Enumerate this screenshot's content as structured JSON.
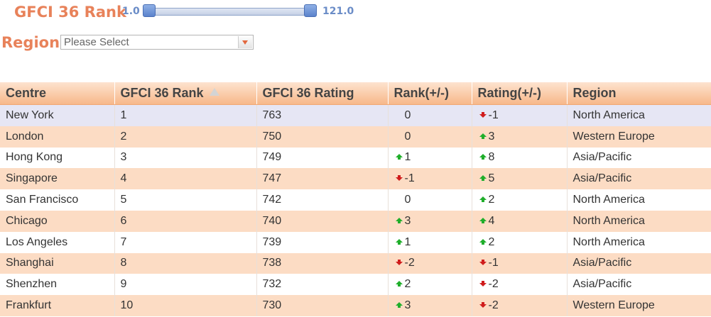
{
  "filters": {
    "rank_label": "GFCI 36 Rank",
    "rank_min": "1.0",
    "rank_max": "121.0",
    "region_label": "Region",
    "region_placeholder": "Please Select"
  },
  "colors": {
    "label": "#e8825a",
    "header_bg": "#f7b88a",
    "row_alt": "#fcdcc4",
    "row_selected": "#e6e6f4",
    "up": "#1fae2a",
    "down": "#d01c1c"
  },
  "table": {
    "columns": [
      "Centre",
      "GFCI 36 Rank",
      "GFCI 36 Rating",
      "Rank(+/-)",
      "Rating(+/-)",
      "Region"
    ],
    "sorted_column_icon": "sort-ascending-icon",
    "rows": [
      {
        "centre": "New York",
        "rank": "1",
        "rating": "763",
        "rank_change": "0",
        "rank_dir": "none",
        "rating_change": "-1",
        "rating_dir": "down",
        "region": "North America"
      },
      {
        "centre": "London",
        "rank": "2",
        "rating": "750",
        "rank_change": "0",
        "rank_dir": "none",
        "rating_change": "3",
        "rating_dir": "up",
        "region": "Western Europe"
      },
      {
        "centre": "Hong Kong",
        "rank": "3",
        "rating": "749",
        "rank_change": "1",
        "rank_dir": "up",
        "rating_change": "8",
        "rating_dir": "up",
        "region": "Asia/Pacific"
      },
      {
        "centre": "Singapore",
        "rank": "4",
        "rating": "747",
        "rank_change": "-1",
        "rank_dir": "down",
        "rating_change": "5",
        "rating_dir": "up",
        "region": "Asia/Pacific"
      },
      {
        "centre": "San Francisco",
        "rank": "5",
        "rating": "742",
        "rank_change": "0",
        "rank_dir": "none",
        "rating_change": "2",
        "rating_dir": "up",
        "region": "North America"
      },
      {
        "centre": "Chicago",
        "rank": "6",
        "rating": "740",
        "rank_change": "3",
        "rank_dir": "up",
        "rating_change": "4",
        "rating_dir": "up",
        "region": "North America"
      },
      {
        "centre": "Los Angeles",
        "rank": "7",
        "rating": "739",
        "rank_change": "1",
        "rank_dir": "up",
        "rating_change": "2",
        "rating_dir": "up",
        "region": "North America"
      },
      {
        "centre": "Shanghai",
        "rank": "8",
        "rating": "738",
        "rank_change": "-2",
        "rank_dir": "down",
        "rating_change": "-1",
        "rating_dir": "down",
        "region": "Asia/Pacific"
      },
      {
        "centre": "Shenzhen",
        "rank": "9",
        "rating": "732",
        "rank_change": "2",
        "rank_dir": "up",
        "rating_change": "-2",
        "rating_dir": "down",
        "region": "Asia/Pacific"
      },
      {
        "centre": "Frankfurt",
        "rank": "10",
        "rating": "730",
        "rank_change": "3",
        "rank_dir": "up",
        "rating_change": "-2",
        "rating_dir": "down",
        "region": "Western Europe"
      }
    ]
  }
}
